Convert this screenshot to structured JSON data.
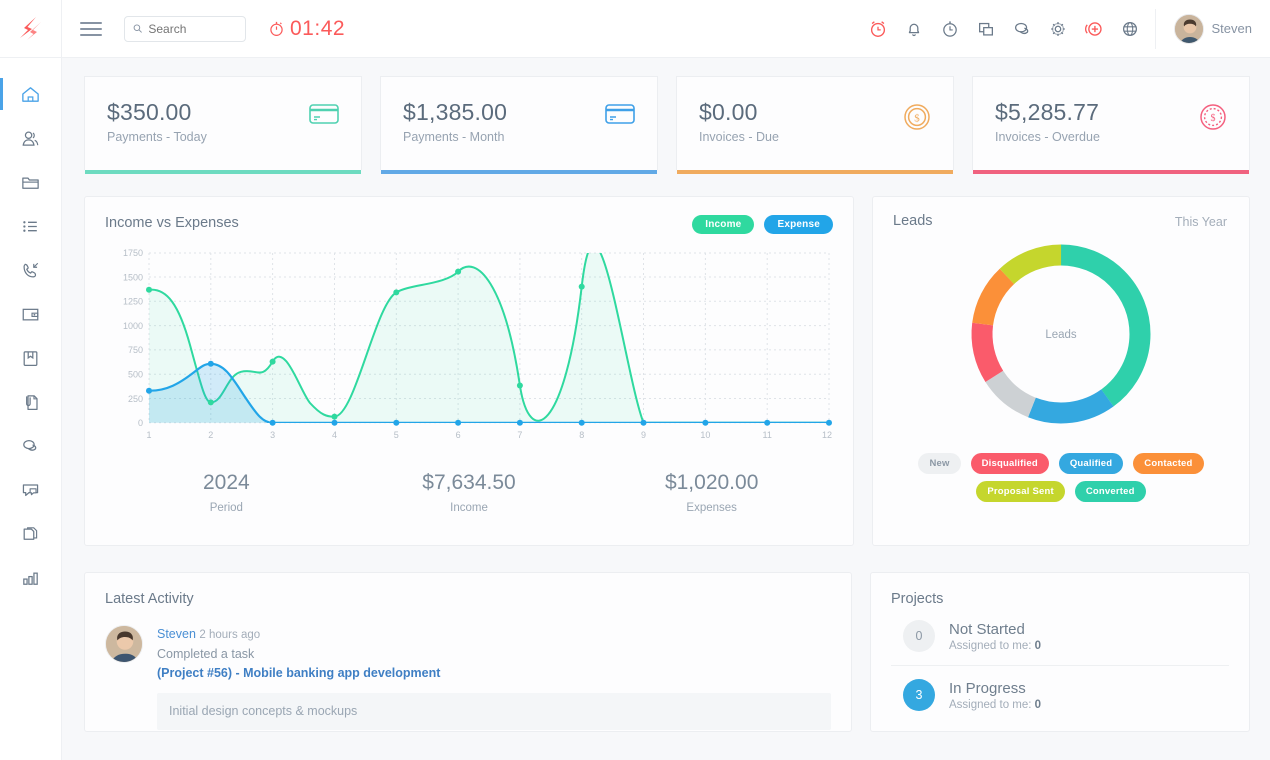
{
  "topbar": {
    "logo_icon": "flame-logo-icon",
    "menu_icon": "hamburger-menu-icon",
    "search": {
      "placeholder": "Search",
      "value": "",
      "icon": "search-icon"
    },
    "timer": {
      "icon": "stopwatch-icon",
      "value": "01:42",
      "color": "#fb5a5a"
    },
    "icons": [
      {
        "name": "alarm-clock-icon",
        "accent": true
      },
      {
        "name": "bell-icon",
        "accent": false
      },
      {
        "name": "timer-icon",
        "accent": false
      },
      {
        "name": "windows-icon",
        "accent": false
      },
      {
        "name": "chat-bubbles-icon",
        "accent": false
      },
      {
        "name": "gear-icon",
        "accent": false
      },
      {
        "name": "add-circle-icon",
        "accent": true
      },
      {
        "name": "globe-icon",
        "accent": false
      }
    ],
    "user": {
      "name": "Steven",
      "avatar": "user-avatar"
    }
  },
  "sidebar": {
    "items": [
      {
        "name": "home",
        "icon": "home-icon",
        "active": true
      },
      {
        "name": "contacts",
        "icon": "user-group-icon",
        "active": false
      },
      {
        "name": "projects",
        "icon": "folder-icon",
        "active": false
      },
      {
        "name": "tasks",
        "icon": "list-icon",
        "active": false
      },
      {
        "name": "calls",
        "icon": "phone-incoming-icon",
        "active": false
      },
      {
        "name": "payments",
        "icon": "wallet-icon",
        "active": false
      },
      {
        "name": "knowledge-base",
        "icon": "book-icon",
        "active": false
      },
      {
        "name": "documents",
        "icon": "paperclip-file-icon",
        "active": false
      },
      {
        "name": "discussions",
        "icon": "chat-bubbles-icon",
        "active": false
      },
      {
        "name": "support",
        "icon": "support-chat-icon",
        "active": false
      },
      {
        "name": "files",
        "icon": "copy-files-icon",
        "active": false
      },
      {
        "name": "reports",
        "icon": "bar-chart-icon",
        "active": false
      }
    ]
  },
  "stats": [
    {
      "value": "$350.00",
      "label": "Payments - Today",
      "icon": "credit-card-icon",
      "color": "#4fd1b0",
      "bar": "#6ddbc0"
    },
    {
      "value": "$1,385.00",
      "label": "Payments - Month",
      "icon": "credit-card-icon",
      "color": "#3fa0e8",
      "bar": "#61a9e6"
    },
    {
      "value": "$0.00",
      "label": "Invoices - Due",
      "icon": "coin-dollar-icon",
      "color": "#f5a council",
      "bar": "#f0ab5e"
    },
    {
      "value": "$5,285.77",
      "label": "Invoices - Overdue",
      "icon": "coin-dashed-icon",
      "color": "#f4607f",
      "bar": "#f0627f"
    }
  ],
  "income_chart": {
    "title": "Income vs Expenses",
    "legend": [
      {
        "label": "Income",
        "color": "#2fd99f"
      },
      {
        "label": "Expense",
        "color": "#22a5e8"
      }
    ],
    "footer": [
      {
        "value": "2024",
        "label": "Period"
      },
      {
        "value": "$7,634.50",
        "label": "Income"
      },
      {
        "value": "$1,020.00",
        "label": "Expenses"
      }
    ]
  },
  "chart_data": {
    "type": "area",
    "title": "Income vs Expenses",
    "xlabel": "",
    "ylabel": "",
    "x": [
      1,
      2,
      3,
      4,
      5,
      6,
      7,
      8,
      9,
      10,
      11,
      12
    ],
    "xtick_labels": [
      "1",
      "2",
      "3",
      "4",
      "5",
      "6",
      "7",
      "8",
      "9",
      "10",
      "11",
      "12"
    ],
    "ytick_labels": [
      "0",
      "250",
      "500",
      "750",
      "1000",
      "1250",
      "1500",
      "1750"
    ],
    "ylim": [
      0,
      1750
    ],
    "grid": true,
    "legend_position": "top-right",
    "series": [
      {
        "name": "Income",
        "color": "#2fd99f",
        "fill": "#e4f7f4",
        "values": [
          1370,
          210,
          630,
          270,
          1340,
          1560,
          385,
          1400,
          0,
          0,
          0,
          0
        ]
      },
      {
        "name": "Expense",
        "color": "#22a5e8",
        "fill": "#bfe4f5",
        "values": [
          330,
          620,
          0,
          0,
          0,
          0,
          0,
          0,
          0,
          0,
          0,
          0
        ]
      }
    ]
  },
  "leads": {
    "title": "Leads",
    "period": "This Year",
    "center_label": "Leads",
    "chart_data": {
      "type": "pie",
      "title": "Leads",
      "labels": [
        "Converted",
        "Qualified",
        "New",
        "Disqualified",
        "Contacted",
        "Proposal Sent"
      ],
      "values": [
        40,
        16,
        10,
        11,
        11,
        12
      ],
      "colors": [
        "#2fd0ab",
        "#34a8e0",
        "#cdd1d4",
        "#fa5b6b",
        "#fb9039",
        "#c5d62d"
      ]
    },
    "tags": [
      {
        "label": "New",
        "color": "#eef0f2",
        "text": "#8c98a5"
      },
      {
        "label": "Disqualified",
        "color": "#fa5b6b",
        "text": "#ffffff"
      },
      {
        "label": "Qualified",
        "color": "#34a8e0",
        "text": "#ffffff"
      },
      {
        "label": "Contacted",
        "color": "#fb9039",
        "text": "#ffffff"
      },
      {
        "label": "Proposal Sent",
        "color": "#c5d62d",
        "text": "#ffffff"
      },
      {
        "label": "Converted",
        "color": "#2fd0ab",
        "text": "#ffffff"
      }
    ]
  },
  "activity": {
    "title": "Latest Activity",
    "items": [
      {
        "user": "Steven",
        "time": "2 hours ago",
        "action": "Completed a task",
        "link": "(Project #56) - Mobile banking app development",
        "note": "Initial design concepts & mockups"
      }
    ]
  },
  "projects": {
    "title": "Projects",
    "items": [
      {
        "count": "0",
        "name": "Not Started",
        "assigned_label": "Assigned to me:",
        "assigned": "0",
        "color": "#eef0f2",
        "text": "#8c98a5"
      },
      {
        "count": "3",
        "name": "In Progress",
        "assigned_label": "Assigned to me:",
        "assigned": "0",
        "color": "#34a8e0",
        "text": "#ffffff"
      }
    ]
  }
}
